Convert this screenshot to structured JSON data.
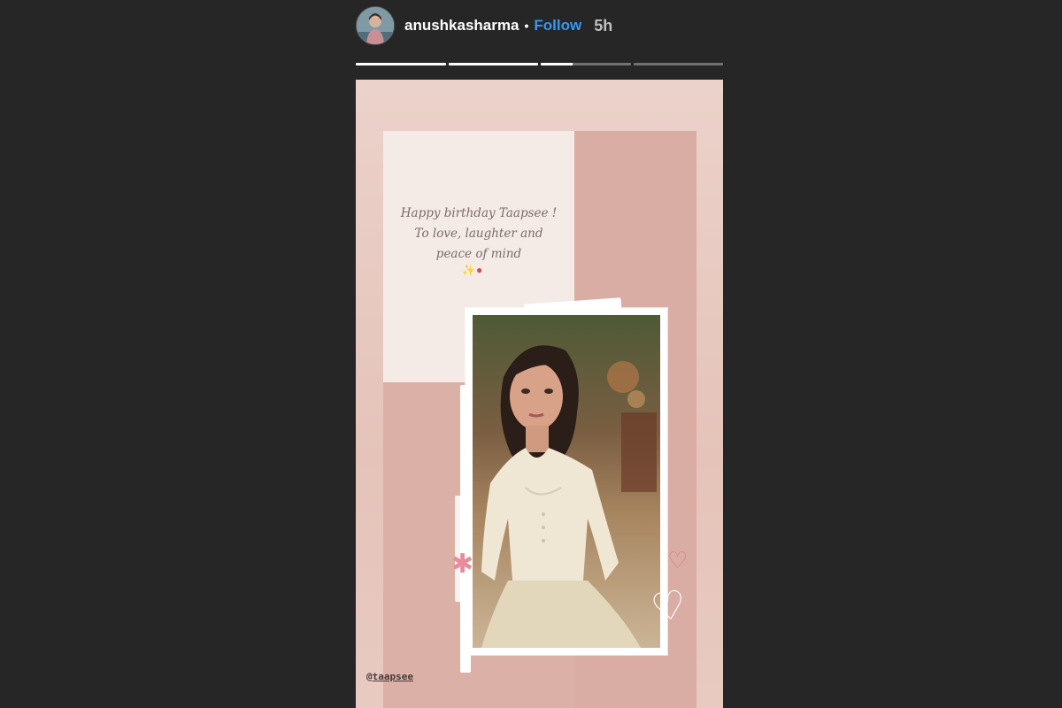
{
  "header": {
    "username": "anushkasharma",
    "separator": "•",
    "follow_label": "Follow",
    "time": "5h"
  },
  "progress": [
    1.0,
    1.0,
    0.35,
    0.0
  ],
  "story": {
    "message_lines": [
      "Happy birthday Taapsee !",
      "To love, laughter and",
      "peace of mind"
    ],
    "emoji_symbols": "✨",
    "emoji_red": "●",
    "mention_prefix": "@",
    "mention_user": "taapsee"
  },
  "colors": {
    "follow": "#3897f0",
    "background": "#262626",
    "story_bg": "#ebd2ca"
  },
  "icons": {
    "sparkle": "✱",
    "heart_outline": "♡",
    "heart_white": "♡"
  }
}
